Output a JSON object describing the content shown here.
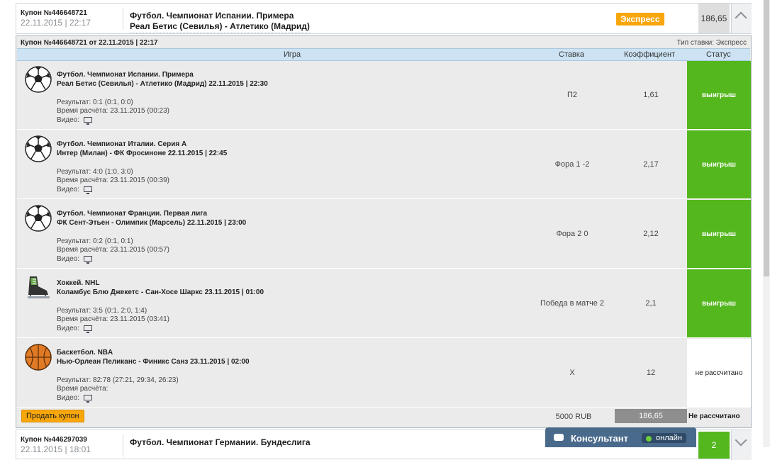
{
  "coupon": {
    "number": "Купон №446648721",
    "date": "22.11.2015 | 22:17",
    "title": "Футбол. Чемпионат Испании. Примера",
    "teams": "Реал Бетис (Севилья) - Атлетико (Мадрид)",
    "badge": "Экспресс",
    "odds": "186,65"
  },
  "details": {
    "title": "Купон №446648721 от 22.11.2015 | 22:17",
    "bet_type": "Тип ставки: Экспресс",
    "columns": {
      "game": "Игра",
      "bet": "Ставка",
      "coef": "Коэффициент",
      "status": "Статус"
    },
    "rows": [
      {
        "icon": "soccer-ball-icon",
        "champ": "Футбол. Чемпионат Испании. Примера",
        "match": "Реал Бетис (Севилья) - Атлетико (Мадрид) 22.11.2015 | 22:30",
        "result": "Результат: 0:1 (0:1, 0:0)",
        "time": "Время расчёта: 23.11.2015 (00:23)",
        "video": "Видео:",
        "bet": "П2",
        "coef": "1,61",
        "status": "выигрыш",
        "won": true
      },
      {
        "icon": "soccer-ball-icon",
        "champ": "Футбол. Чемпионат Италии. Серия А",
        "match": "Интер (Милан) - ФК Фросиноне 22.11.2015 | 22:45",
        "result": "Результат: 4:0 (1:0, 3:0)",
        "time": "Время расчёта: 23.11.2015 (00:39)",
        "video": "Видео:",
        "bet": "Фора 1 -2",
        "coef": "2,17",
        "status": "выигрыш",
        "won": true
      },
      {
        "icon": "soccer-ball-icon",
        "champ": "Футбол. Чемпионат Франции. Первая лига",
        "match": "ФК Сент-Этьен - Олимпик (Марсель) 22.11.2015 | 23:00",
        "result": "Результат: 0:2 (0:1, 0:1)",
        "time": "Время расчёта: 23.11.2015 (00:57)",
        "video": "Видео:",
        "bet": "Фора 2 0",
        "coef": "2,12",
        "status": "выигрыш",
        "won": true
      },
      {
        "icon": "hockey-skate-icon",
        "champ": "Хоккей. NHL",
        "match": "Коламбус Блю Джекетс - Сан-Хосе Шаркс 23.11.2015 | 01:00",
        "result": "Результат: 3:5 (0:1, 2:0, 1:4)",
        "time": "Время расчёта: 23.11.2015 (03:41)",
        "video": "Видео:",
        "bet": "Победа в матче 2",
        "coef": "2,1",
        "status": "выигрыш",
        "won": true
      },
      {
        "icon": "basketball-icon",
        "champ": "Баскетбол. NBA",
        "match": "Нью-Орлеан Пеликанс - Финикс Санз 23.11.2015 | 02:00",
        "result": "Результат: 82:78 (27:21, 29:34, 26:23)",
        "time": "Время расчёта:",
        "video": "Видео:",
        "bet": "X",
        "coef": "12",
        "status": "не рассчитано",
        "won": false
      }
    ],
    "footer": {
      "sell_label": "Продать купон",
      "stake": "5000 RUB",
      "total_odds": "186,65",
      "status": "Не рассчитано"
    }
  },
  "coupon2": {
    "number": "Купон №446297039",
    "date": "22.11.2015 | 18:01",
    "title": "Футбол. Чемпионат Германии. Бундеслига",
    "odds": "2"
  },
  "consultant": {
    "label": "Консультант",
    "status": "онлайн"
  },
  "colors": {
    "win": "#55b71e",
    "accent": "#f7a60b",
    "header_blue": "#cde3f3"
  }
}
